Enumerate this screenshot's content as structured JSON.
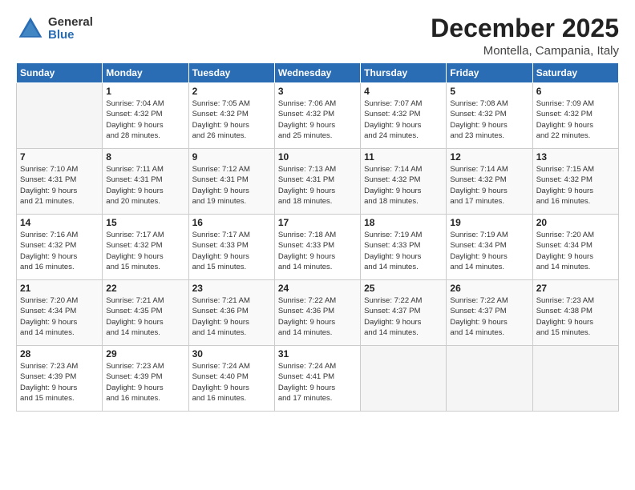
{
  "logo": {
    "general": "General",
    "blue": "Blue"
  },
  "title": "December 2025",
  "location": "Montella, Campania, Italy",
  "days_of_week": [
    "Sunday",
    "Monday",
    "Tuesday",
    "Wednesday",
    "Thursday",
    "Friday",
    "Saturday"
  ],
  "weeks": [
    [
      {
        "day": "",
        "info": ""
      },
      {
        "day": "1",
        "info": "Sunrise: 7:04 AM\nSunset: 4:32 PM\nDaylight: 9 hours\nand 28 minutes."
      },
      {
        "day": "2",
        "info": "Sunrise: 7:05 AM\nSunset: 4:32 PM\nDaylight: 9 hours\nand 26 minutes."
      },
      {
        "day": "3",
        "info": "Sunrise: 7:06 AM\nSunset: 4:32 PM\nDaylight: 9 hours\nand 25 minutes."
      },
      {
        "day": "4",
        "info": "Sunrise: 7:07 AM\nSunset: 4:32 PM\nDaylight: 9 hours\nand 24 minutes."
      },
      {
        "day": "5",
        "info": "Sunrise: 7:08 AM\nSunset: 4:32 PM\nDaylight: 9 hours\nand 23 minutes."
      },
      {
        "day": "6",
        "info": "Sunrise: 7:09 AM\nSunset: 4:32 PM\nDaylight: 9 hours\nand 22 minutes."
      }
    ],
    [
      {
        "day": "7",
        "info": "Sunrise: 7:10 AM\nSunset: 4:31 PM\nDaylight: 9 hours\nand 21 minutes."
      },
      {
        "day": "8",
        "info": "Sunrise: 7:11 AM\nSunset: 4:31 PM\nDaylight: 9 hours\nand 20 minutes."
      },
      {
        "day": "9",
        "info": "Sunrise: 7:12 AM\nSunset: 4:31 PM\nDaylight: 9 hours\nand 19 minutes."
      },
      {
        "day": "10",
        "info": "Sunrise: 7:13 AM\nSunset: 4:31 PM\nDaylight: 9 hours\nand 18 minutes."
      },
      {
        "day": "11",
        "info": "Sunrise: 7:14 AM\nSunset: 4:32 PM\nDaylight: 9 hours\nand 18 minutes."
      },
      {
        "day": "12",
        "info": "Sunrise: 7:14 AM\nSunset: 4:32 PM\nDaylight: 9 hours\nand 17 minutes."
      },
      {
        "day": "13",
        "info": "Sunrise: 7:15 AM\nSunset: 4:32 PM\nDaylight: 9 hours\nand 16 minutes."
      }
    ],
    [
      {
        "day": "14",
        "info": "Sunrise: 7:16 AM\nSunset: 4:32 PM\nDaylight: 9 hours\nand 16 minutes."
      },
      {
        "day": "15",
        "info": "Sunrise: 7:17 AM\nSunset: 4:32 PM\nDaylight: 9 hours\nand 15 minutes."
      },
      {
        "day": "16",
        "info": "Sunrise: 7:17 AM\nSunset: 4:33 PM\nDaylight: 9 hours\nand 15 minutes."
      },
      {
        "day": "17",
        "info": "Sunrise: 7:18 AM\nSunset: 4:33 PM\nDaylight: 9 hours\nand 14 minutes."
      },
      {
        "day": "18",
        "info": "Sunrise: 7:19 AM\nSunset: 4:33 PM\nDaylight: 9 hours\nand 14 minutes."
      },
      {
        "day": "19",
        "info": "Sunrise: 7:19 AM\nSunset: 4:34 PM\nDaylight: 9 hours\nand 14 minutes."
      },
      {
        "day": "20",
        "info": "Sunrise: 7:20 AM\nSunset: 4:34 PM\nDaylight: 9 hours\nand 14 minutes."
      }
    ],
    [
      {
        "day": "21",
        "info": "Sunrise: 7:20 AM\nSunset: 4:34 PM\nDaylight: 9 hours\nand 14 minutes."
      },
      {
        "day": "22",
        "info": "Sunrise: 7:21 AM\nSunset: 4:35 PM\nDaylight: 9 hours\nand 14 minutes."
      },
      {
        "day": "23",
        "info": "Sunrise: 7:21 AM\nSunset: 4:36 PM\nDaylight: 9 hours\nand 14 minutes."
      },
      {
        "day": "24",
        "info": "Sunrise: 7:22 AM\nSunset: 4:36 PM\nDaylight: 9 hours\nand 14 minutes."
      },
      {
        "day": "25",
        "info": "Sunrise: 7:22 AM\nSunset: 4:37 PM\nDaylight: 9 hours\nand 14 minutes."
      },
      {
        "day": "26",
        "info": "Sunrise: 7:22 AM\nSunset: 4:37 PM\nDaylight: 9 hours\nand 14 minutes."
      },
      {
        "day": "27",
        "info": "Sunrise: 7:23 AM\nSunset: 4:38 PM\nDaylight: 9 hours\nand 15 minutes."
      }
    ],
    [
      {
        "day": "28",
        "info": "Sunrise: 7:23 AM\nSunset: 4:39 PM\nDaylight: 9 hours\nand 15 minutes."
      },
      {
        "day": "29",
        "info": "Sunrise: 7:23 AM\nSunset: 4:39 PM\nDaylight: 9 hours\nand 16 minutes."
      },
      {
        "day": "30",
        "info": "Sunrise: 7:24 AM\nSunset: 4:40 PM\nDaylight: 9 hours\nand 16 minutes."
      },
      {
        "day": "31",
        "info": "Sunrise: 7:24 AM\nSunset: 4:41 PM\nDaylight: 9 hours\nand 17 minutes."
      },
      {
        "day": "",
        "info": ""
      },
      {
        "day": "",
        "info": ""
      },
      {
        "day": "",
        "info": ""
      }
    ]
  ]
}
